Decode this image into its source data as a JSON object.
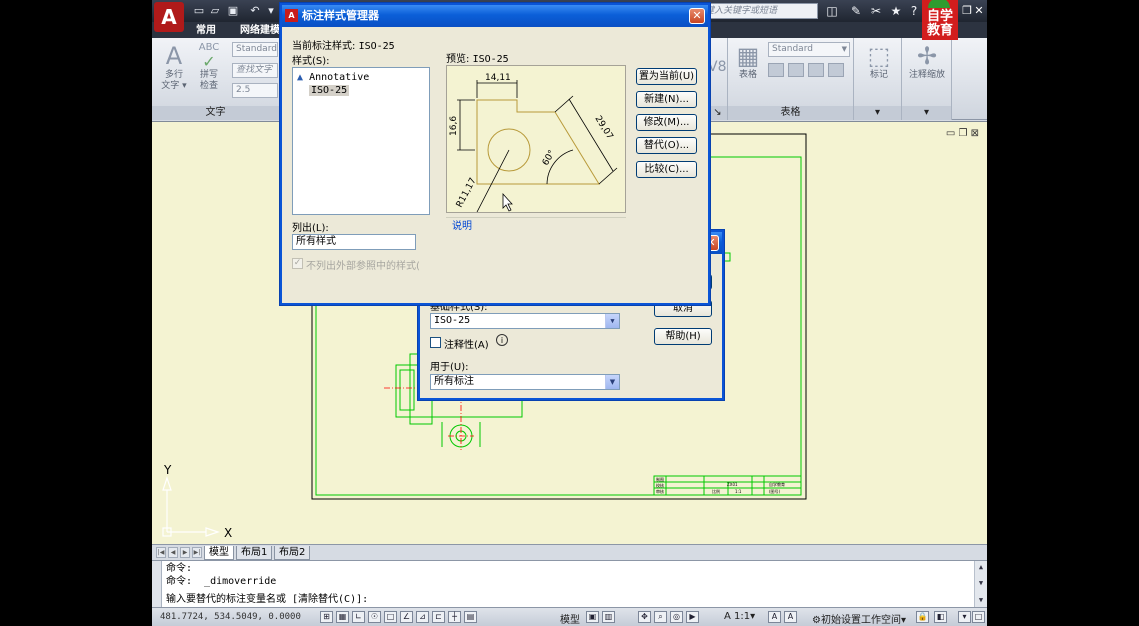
{
  "app": {
    "logo_letter": "A",
    "help_search_placeholder": "键入关键字或短语",
    "brand_text": "自学教育",
    "qa_icons": [
      "new-icon",
      "open-icon",
      "save-icon",
      "undo-icon"
    ],
    "window_controls": [
      "minimize",
      "restore",
      "close"
    ]
  },
  "ribbon": {
    "tabs": [
      {
        "label": "常用",
        "active": false
      },
      {
        "label": "网络建模",
        "active": false
      }
    ],
    "text_panel": {
      "title": "文字",
      "multiline_text": "多行文字",
      "multiline_text_line1": "多行",
      "multiline_text_line2": "文字",
      "spell_check_line1": "拼写",
      "spell_check_line2": "检查",
      "abc_glyph": "ABC",
      "style_combo": "Standard",
      "find_text": "查找文字",
      "height_value": "2.5"
    },
    "table_panel": {
      "title": "表格",
      "style_combo": "Standard",
      "table_button": "表格",
      "number_glyph": "V8"
    },
    "markup_panel": {
      "title": "",
      "label": "标记"
    },
    "annotation_panel": {
      "label": "注释缩放"
    }
  },
  "canvas": {
    "ucs_x": "X",
    "ucs_y": "Y",
    "title_block": {
      "cell_a": "制图",
      "cell_b": "校核",
      "cell_c": "审核",
      "part_code": "ZX01",
      "scale_label": "比例",
      "scale_value": "1:1",
      "qty": "1",
      "company": "自学教育",
      "sheet": "(图号)"
    }
  },
  "layout_tabs": [
    {
      "label": "模型",
      "active": true
    },
    {
      "label": "布局1",
      "active": false
    },
    {
      "label": "布局2",
      "active": false
    }
  ],
  "command": {
    "line1": "命令:",
    "line2": "命令:  _dimoverride",
    "line3": "输入要替代的标注变量名或 [清除替代(C)]:"
  },
  "status": {
    "coordinates": "481.7724, 534.5049, 0.0000",
    "model_label": "模型",
    "annotation_scale": "1:1",
    "workspace": "初始设置工作空间"
  },
  "dim_style_manager": {
    "title": "标注样式管理器",
    "current_style_label": "当前标注样式:",
    "current_style_value": "ISO-25",
    "styles_label": "样式(S):",
    "styles": [
      "Annotative",
      "ISO-25"
    ],
    "selected_style": "ISO-25",
    "list_label": "列出(L):",
    "list_value": "所有样式",
    "xref_checkbox": "不列出外部参照中的样式(",
    "preview_label": "预览:",
    "preview_style": "ISO-25",
    "description_label": "说明",
    "buttons": {
      "set_current": "置为当前(U)",
      "new": "新建(N)...",
      "modify": "修改(M)...",
      "override": "替代(O)...",
      "compare": "比较(C)..."
    },
    "preview_dims": {
      "width": "14,11",
      "height": "16,6",
      "diagonal": "29,07",
      "angle": "60°",
      "radius": "R11,17"
    }
  },
  "new_dim_style": {
    "cancel": "取消",
    "help": "帮助(H)",
    "base_style_label": "基础样式(S):",
    "base_style_value": "ISO-25",
    "annotative_label": "注释性(A)",
    "use_for_label": "用于(U):",
    "use_for_value": "所有标注"
  },
  "colors": {
    "xp_title": "#0a54d6",
    "canvas_bg": "#f4f3d2",
    "drawing_green": "#00c800",
    "drawing_red": "#ff0000"
  }
}
